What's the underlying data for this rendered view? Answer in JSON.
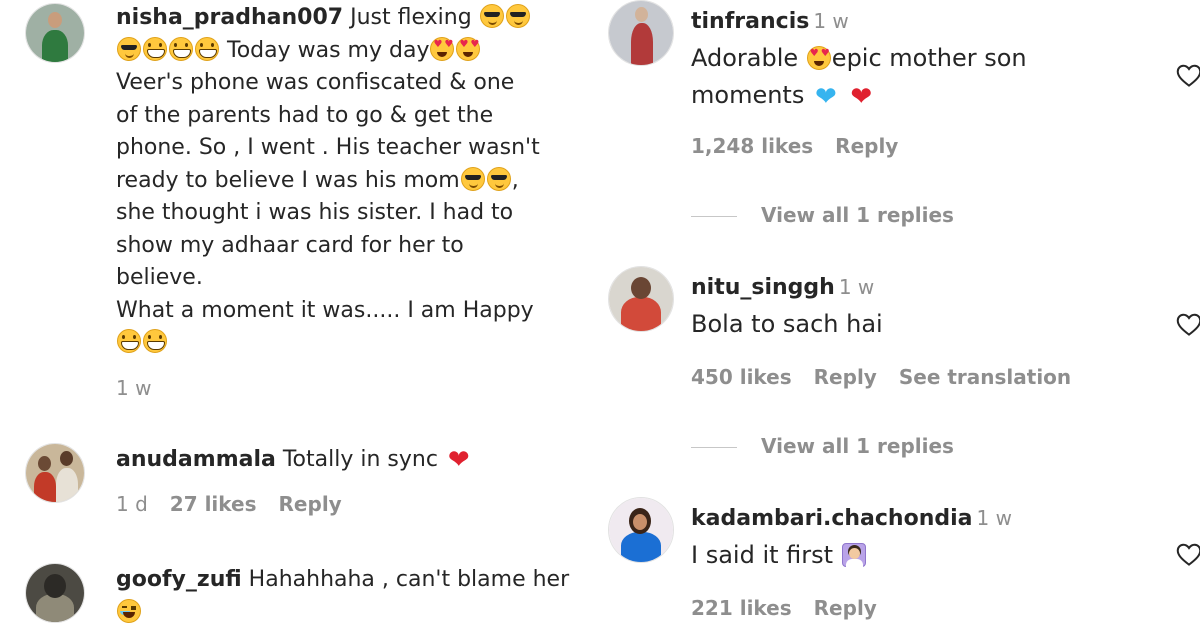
{
  "comments_left": [
    {
      "username": "nisha_pradhan007",
      "text_lines": [
        "Just flexing"
      ],
      "line2": "Today was my day",
      "body_lines": [
        "Veer's phone was confiscated & one",
        "of the parents had to go & get the",
        "phone. So , I went . His teacher wasn't",
        "ready to believe I was his mom"
      ],
      "body_after": [
        "she thought i was his sister. I had to",
        "show my adhaar card for her to",
        "believe.",
        "What a moment it was..... I am Happy"
      ],
      "time": "1 w",
      "avatar_colors": {
        "bg": "#9fb0a4",
        "body": "#2f7a3f",
        "head": "#c99d7c"
      }
    },
    {
      "username": "anudammala",
      "text": "Totally in sync",
      "time": "1 d",
      "likes": "27 likes",
      "reply": "Reply",
      "avatar_colors": {
        "bg": "#c9b79a",
        "body": "#c23a28",
        "head": "#6b4a35"
      }
    },
    {
      "username": "goofy_zufi",
      "text": "Hahahhaha , can't blame her",
      "avatar_colors": {
        "bg": "#4c4a43",
        "body": "#8f8a78",
        "head": "#2c2a26"
      }
    }
  ],
  "comments_right": [
    {
      "username": "tinfrancis",
      "time": "1 w",
      "text_a": "Adorable",
      "text_b": "epic mother son",
      "text_c": "moments",
      "likes": "1,248 likes",
      "reply": "Reply",
      "view_replies": "View all 1 replies",
      "avatar_colors": {
        "bg": "#c6c9cf",
        "body": "#b23a3a",
        "head": "#d2b39a"
      }
    },
    {
      "username": "nitu_singgh",
      "time": "1 w",
      "text": "Bola to sach hai",
      "likes": "450 likes",
      "reply": "Reply",
      "translation": "See translation",
      "view_replies": "View all 1 replies",
      "avatar_colors": {
        "bg": "#d9d6cf",
        "body": "#d24a3a",
        "head": "#6a4634"
      }
    },
    {
      "username": "kadambari.chachondia",
      "time": "1 w",
      "text": "I said it first",
      "likes": "221 likes",
      "reply": "Reply",
      "avatar_colors": {
        "bg": "#f0eaf0",
        "body": "#1b6fd4",
        "head": "#3a2418"
      }
    }
  ],
  "icons": {
    "like": "heart-outline-icon"
  },
  "colors": {
    "text": "#262626",
    "muted": "#8e8e8e",
    "red_heart": "#e0212f",
    "blue_heart": "#36b4ef"
  }
}
